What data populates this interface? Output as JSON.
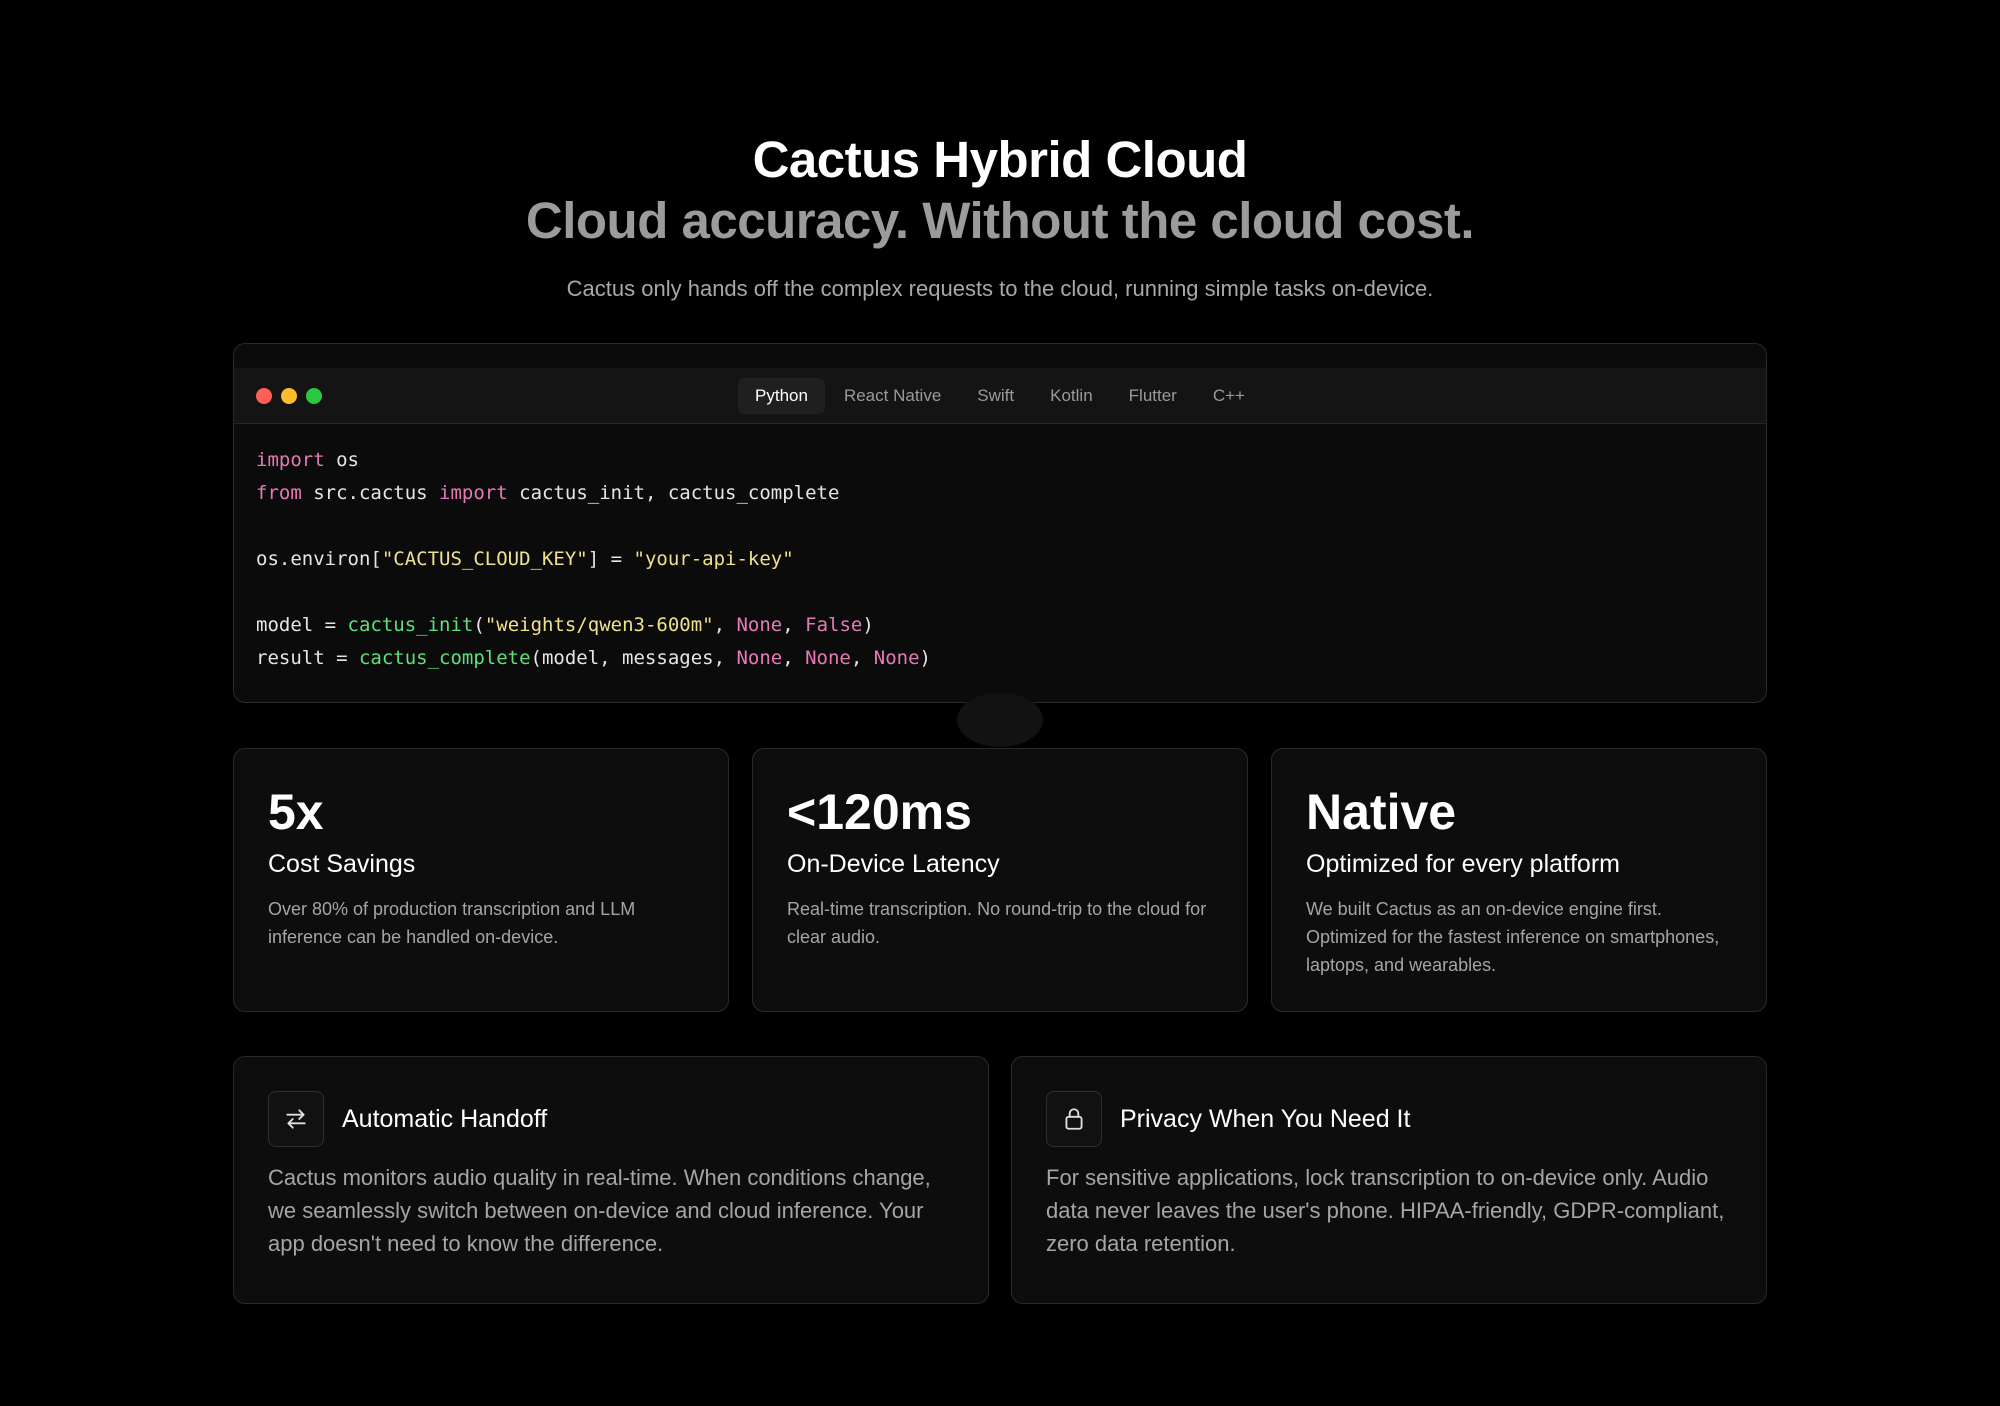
{
  "hero": {
    "title": "Cactus Hybrid Cloud",
    "subtitle": "Cloud accuracy. Without the cloud cost.",
    "description": "Cactus only hands off the complex requests to the cloud, running simple tasks on-device."
  },
  "code_window": {
    "tabs": [
      "Python",
      "React Native",
      "Swift",
      "Kotlin",
      "Flutter",
      "C++"
    ],
    "active_tab": "Python",
    "lines": [
      [
        {
          "t": "kw",
          "v": "import"
        },
        {
          "t": "plain",
          "v": " os"
        }
      ],
      [
        {
          "t": "kw",
          "v": "from"
        },
        {
          "t": "plain",
          "v": " src.cactus "
        },
        {
          "t": "kw",
          "v": "import"
        },
        {
          "t": "plain",
          "v": " cactus_init, cactus_complete"
        }
      ],
      [],
      [
        {
          "t": "plain",
          "v": "os.environ["
        },
        {
          "t": "str",
          "v": "\"CACTUS_CLOUD_KEY\""
        },
        {
          "t": "plain",
          "v": "] = "
        },
        {
          "t": "str",
          "v": "\"your-api-key\""
        }
      ],
      [],
      [
        {
          "t": "plain",
          "v": "model = "
        },
        {
          "t": "fn",
          "v": "cactus_init"
        },
        {
          "t": "plain",
          "v": "("
        },
        {
          "t": "str",
          "v": "\"weights/qwen3-600m\""
        },
        {
          "t": "plain",
          "v": ", "
        },
        {
          "t": "const",
          "v": "None"
        },
        {
          "t": "plain",
          "v": ", "
        },
        {
          "t": "const",
          "v": "False"
        },
        {
          "t": "plain",
          "v": ")"
        }
      ],
      [
        {
          "t": "plain",
          "v": "result = "
        },
        {
          "t": "fn",
          "v": "cactus_complete"
        },
        {
          "t": "plain",
          "v": "(model, messages, "
        },
        {
          "t": "const",
          "v": "None"
        },
        {
          "t": "plain",
          "v": ", "
        },
        {
          "t": "const",
          "v": "None"
        },
        {
          "t": "plain",
          "v": ", "
        },
        {
          "t": "const",
          "v": "None"
        },
        {
          "t": "plain",
          "v": ")"
        }
      ]
    ]
  },
  "stats": [
    {
      "value": "5x",
      "label": "Cost Savings",
      "description": "Over 80% of production transcription and LLM inference can be handled on-device."
    },
    {
      "value": "<120ms",
      "label": "On-Device Latency",
      "description": "Real-time transcription. No round-trip to the cloud for clear audio."
    },
    {
      "value": "Native",
      "label": "Optimized for every platform",
      "description": "We built Cactus as an on-device engine first. Optimized for the fastest inference on smartphones, laptops, and wearables."
    }
  ],
  "features": [
    {
      "icon": "arrows-swap-icon",
      "title": "Automatic Handoff",
      "description": "Cactus monitors audio quality in real-time. When conditions change, we seamlessly switch between on-device and cloud inference. Your app doesn't need to know the difference."
    },
    {
      "icon": "lock-icon",
      "title": "Privacy When You Need It",
      "description": "For sensitive applications, lock transcription to on-device only. Audio data never leaves the user's phone. HIPAA-friendly, GDPR-compliant, zero data retention."
    }
  ],
  "colors": {
    "background": "#000000",
    "card": "#0d0d0d",
    "keyword": "#e879b9",
    "function": "#5ee07a",
    "string": "#f0e28a"
  }
}
